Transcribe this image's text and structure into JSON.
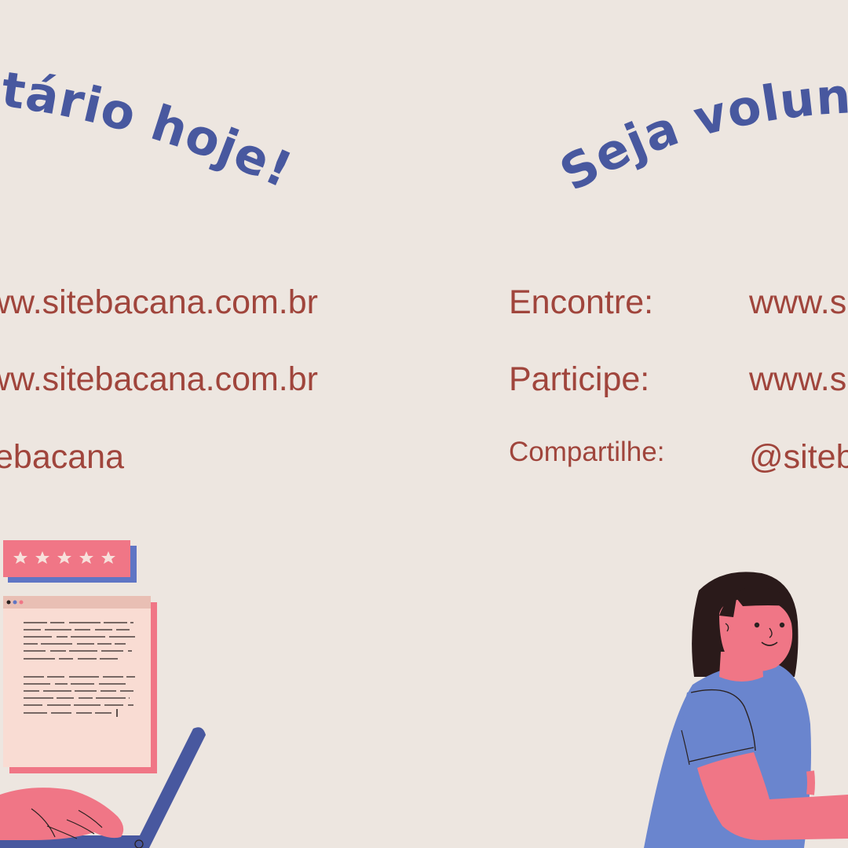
{
  "left_panel": {
    "title": "Seja voluntário hoje!",
    "rows": [
      {
        "value": "www.sitebacana.com.br"
      },
      {
        "value": "www.sitebacana.com.br"
      },
      {
        "value": "@sitebacana"
      }
    ]
  },
  "right_panel": {
    "title": "Seja voluntário hoje!",
    "rows": [
      {
        "label": "Encontre:",
        "value": "www.sitebacana.com.br"
      },
      {
        "label": "Participe:",
        "value": "www.sitebacana.com.br"
      },
      {
        "label": "Compartilhe:",
        "value": "@sitebacana"
      }
    ]
  },
  "colors": {
    "background": "#EDE6E0",
    "title": "#48589F",
    "text": "#A0453C",
    "accent_pink": "#F07686",
    "accent_blue": "#5F75C4"
  },
  "icons": [
    "rating-card-icon",
    "browser-window-icon",
    "laptop-icon",
    "volunteer-woman-illustration"
  ],
  "rating": {
    "stars_filled": 5,
    "stars_total": 5
  }
}
